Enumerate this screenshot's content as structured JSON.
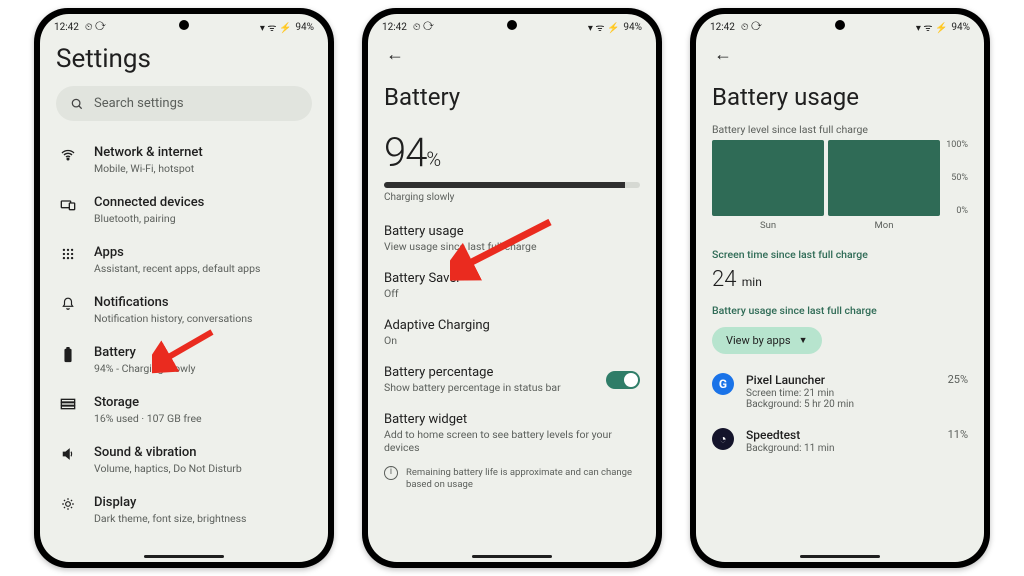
{
  "status": {
    "time": "12:42",
    "battery": "94%"
  },
  "screen1": {
    "title": "Settings",
    "search_placeholder": "Search settings",
    "items": [
      {
        "label": "Network & internet",
        "sub": "Mobile, Wi-Fi, hotspot",
        "icon": "wifi-icon"
      },
      {
        "label": "Connected devices",
        "sub": "Bluetooth, pairing",
        "icon": "devices-icon"
      },
      {
        "label": "Apps",
        "sub": "Assistant, recent apps, default apps",
        "icon": "apps-icon"
      },
      {
        "label": "Notifications",
        "sub": "Notification history, conversations",
        "icon": "bell-icon"
      },
      {
        "label": "Battery",
        "sub": "94% - Charging slowly",
        "icon": "battery-icon"
      },
      {
        "label": "Storage",
        "sub": "16% used · 107 GB free",
        "icon": "storage-icon"
      },
      {
        "label": "Sound & vibration",
        "sub": "Volume, haptics, Do Not Disturb",
        "icon": "sound-icon"
      },
      {
        "label": "Display",
        "sub": "Dark theme, font size, brightness",
        "icon": "display-icon"
      }
    ]
  },
  "screen2": {
    "title": "Battery",
    "percent": "94",
    "percent_unit": "%",
    "progress": 94,
    "charging_caption": "Charging slowly",
    "items": [
      {
        "label": "Battery usage",
        "sub": "View usage since last full charge"
      },
      {
        "label": "Battery Saver",
        "sub": "Off"
      },
      {
        "label": "Adaptive Charging",
        "sub": "On"
      },
      {
        "label": "Battery percentage",
        "sub": "Show battery percentage in status bar",
        "toggle": true
      },
      {
        "label": "Battery widget",
        "sub": "Add to home screen to see battery levels for your devices"
      }
    ],
    "footnote": "Remaining battery life is approximate and can change based on usage"
  },
  "screen3": {
    "title": "Battery usage",
    "level_caption": "Battery level since last full charge",
    "chart_data": {
      "type": "bar",
      "categories": [
        "Sun",
        "Mon"
      ],
      "values": [
        100,
        100
      ],
      "ylim": [
        0,
        100
      ],
      "ytick_labels": [
        "100%",
        "50%",
        "0%"
      ]
    },
    "screen_caption": "Screen time since last full charge",
    "screen_time_value": "24",
    "screen_time_unit": "min",
    "usage_caption": "Battery usage since last full charge",
    "chip_label": "View by apps",
    "apps": [
      {
        "name": "Pixel Launcher",
        "sub": "Screen time: 21 min\nBackground: 5 hr 20 min",
        "pct": "25%",
        "icon": "google"
      },
      {
        "name": "Speedtest",
        "sub": "Background: 11 min",
        "pct": "11%",
        "icon": "speed"
      }
    ]
  }
}
